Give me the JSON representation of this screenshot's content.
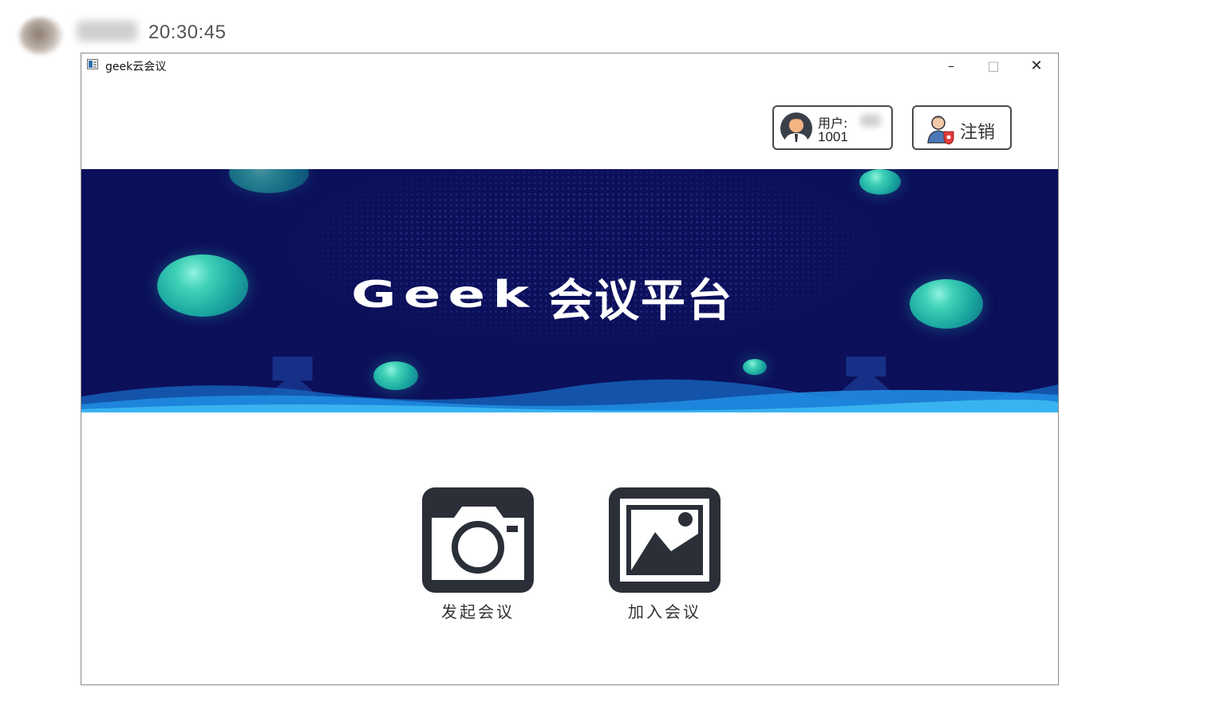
{
  "chat": {
    "time": "20:30:45"
  },
  "window": {
    "title": "geek云会议",
    "controls": {
      "minimize": "–",
      "maximize": "□",
      "close": "✕"
    }
  },
  "user": {
    "label": "用户:",
    "id": "1001",
    "icon": "user-avatar-icon"
  },
  "logout": {
    "label": "注销",
    "icon": "user-shield-icon"
  },
  "banner": {
    "title_en": "Geek",
    "title_cn": "会议平台"
  },
  "actions": [
    {
      "label": "发起会议",
      "icon": "camera-icon"
    },
    {
      "label": "加入会议",
      "icon": "picture-icon"
    }
  ],
  "colors": {
    "banner_bg": "#0c0f5a",
    "bubble": "#2fc4b0",
    "icon_dark": "#2b2f38"
  }
}
